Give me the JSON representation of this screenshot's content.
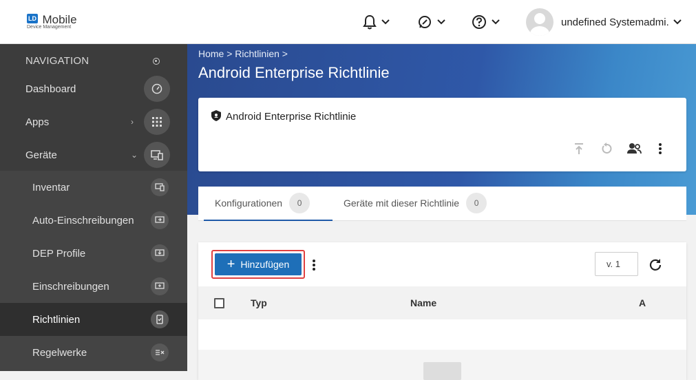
{
  "app": {
    "logo_badge": "LD",
    "logo_name": "Mobile",
    "logo_sub": "Device Management"
  },
  "header": {
    "user_name": "undefined Systemadmi..."
  },
  "sidebar": {
    "heading": "NAVIGATION",
    "items": [
      {
        "label": "Dashboard"
      },
      {
        "label": "Apps"
      },
      {
        "label": "Geräte"
      }
    ],
    "sub_items": [
      {
        "label": "Inventar"
      },
      {
        "label": "Auto-Einschreibungen"
      },
      {
        "label": "DEP Profile"
      },
      {
        "label": "Einschreibungen"
      },
      {
        "label": "Richtlinien"
      },
      {
        "label": "Regelwerke"
      }
    ]
  },
  "page": {
    "breadcrumb": "Home > Richtlinien >",
    "title": "Android Enterprise Richtlinie"
  },
  "policy_card": {
    "title": "Android Enterprise Richtlinie"
  },
  "tabs": [
    {
      "label": "Konfigurationen",
      "count": "0"
    },
    {
      "label": "Geräte mit dieser Richtlinie",
      "count": "0"
    }
  ],
  "toolbar": {
    "add_label": "Hinzufügen",
    "version": "v. 1"
  },
  "table": {
    "columns": [
      "Typ",
      "Name",
      "A"
    ]
  },
  "colors": {
    "accent": "#1e6fb8",
    "highlight": "#e04040",
    "sidebar": "#3c3c3c"
  }
}
